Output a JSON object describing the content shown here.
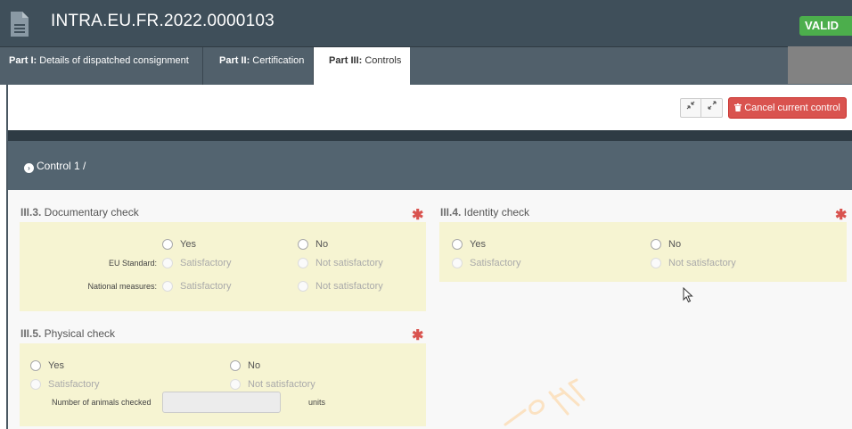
{
  "header": {
    "title": "INTRA.EU.FR.2022.0000103",
    "status": "VALID"
  },
  "tabs": [
    {
      "prefix": "Part I:",
      "label": " Details of dispatched consignment"
    },
    {
      "prefix": "Part II:",
      "label": " Certification"
    },
    {
      "prefix": "Part III:",
      "label": " Controls"
    }
  ],
  "toolbar": {
    "compress_icon": "compress-icon",
    "expand_icon": "expand-icon",
    "cancel_label": "Cancel current control"
  },
  "control": {
    "title": "Control 1 /"
  },
  "doc_check": {
    "code": "III.3.",
    "title": " Documentary check",
    "yes": "Yes",
    "no": "No",
    "eu_label": "EU Standard:",
    "national_label": "National measures:",
    "satisfactory": "Satisfactory",
    "not_satisfactory": "Not satisfactory"
  },
  "identity_check": {
    "code": "III.4.",
    "title": " Identity check",
    "yes": "Yes",
    "no": "No",
    "satisfactory": "Satisfactory",
    "not_satisfactory": "Not satisfactory"
  },
  "physical_check": {
    "code": "III.5.",
    "title": " Physical check",
    "yes": "Yes",
    "no": "No",
    "satisfactory": "Satisfactory",
    "not_satisfactory": "Not satisfactory",
    "animals_label": "Number of animals checked",
    "animals_value": "",
    "units": "units"
  },
  "required_mark": "✱",
  "colors": {
    "header": "#3f4f5a",
    "valid_badge": "#4cae4c",
    "cancel_button": "#d9534f",
    "panel": "#f6f4d2",
    "control_bar": "#536470"
  }
}
